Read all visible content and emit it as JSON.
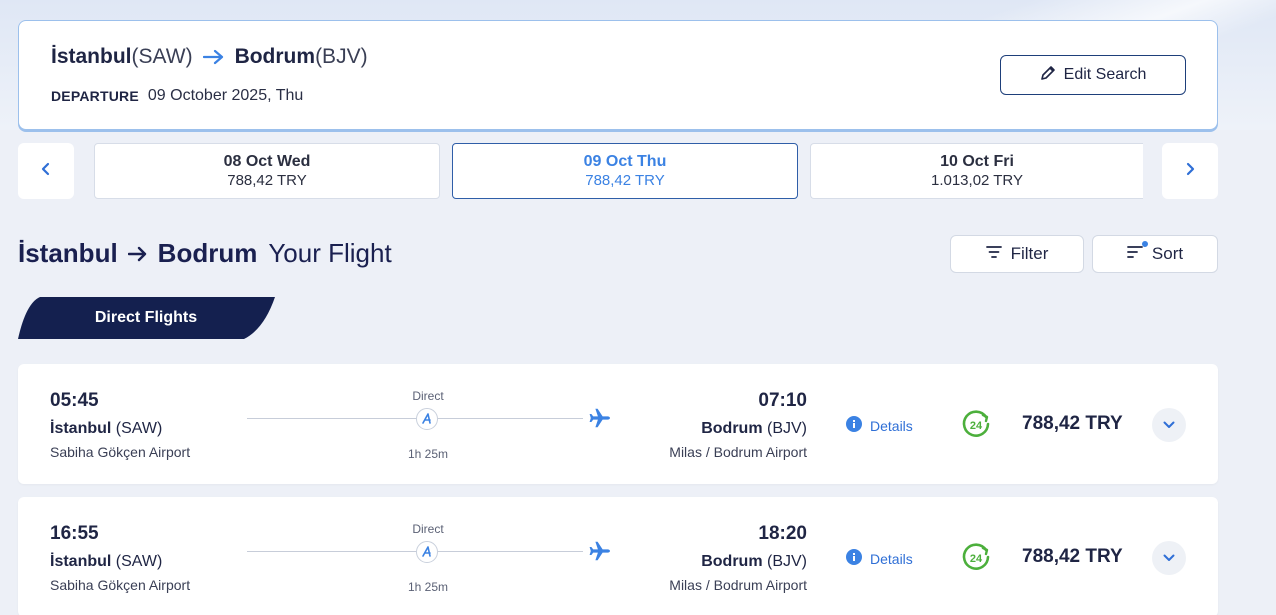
{
  "search": {
    "origin_city": "İstanbul",
    "origin_code": "(SAW)",
    "destination_city": "Bodrum",
    "destination_code": "(BJV)",
    "departure_label": "DEPARTURE",
    "departure_date": "09 October 2025, Thu",
    "edit_label": "Edit Search"
  },
  "dates": [
    {
      "day": "08 Oct Wed",
      "price": "788,42 TRY",
      "active": false
    },
    {
      "day": "09 Oct Thu",
      "price": "788,42 TRY",
      "active": true
    },
    {
      "day": "10 Oct Fri",
      "price": "1.013,02 TRY",
      "active": false
    }
  ],
  "heading": {
    "origin": "İstanbul",
    "destination": "Bodrum",
    "subtitle": "Your Flight"
  },
  "toolbar": {
    "filter_label": "Filter",
    "sort_label": "Sort"
  },
  "tab": {
    "label": "Direct Flights"
  },
  "flights": [
    {
      "dep_time": "05:45",
      "dep_city": "İstanbul",
      "dep_code": "(SAW)",
      "dep_airport": "Sabiha Gökçen Airport",
      "type": "Direct",
      "duration": "1h 25m",
      "arr_time": "07:10",
      "arr_city": "Bodrum",
      "arr_code": "(BJV)",
      "arr_airport": "Milas / Bodrum Airport",
      "details_label": "Details",
      "badge": "24",
      "price": "788,42 TRY"
    },
    {
      "dep_time": "16:55",
      "dep_city": "İstanbul",
      "dep_code": "(SAW)",
      "dep_airport": "Sabiha Gökçen Airport",
      "type": "Direct",
      "duration": "1h 25m",
      "arr_time": "18:20",
      "arr_city": "Bodrum",
      "arr_code": "(BJV)",
      "arr_airport": "Milas / Bodrum Airport",
      "details_label": "Details",
      "badge": "24",
      "price": "788,42 TRY"
    }
  ],
  "colors": {
    "accent": "#3b82e3",
    "navy": "#14204f",
    "green": "#4caf3c"
  }
}
